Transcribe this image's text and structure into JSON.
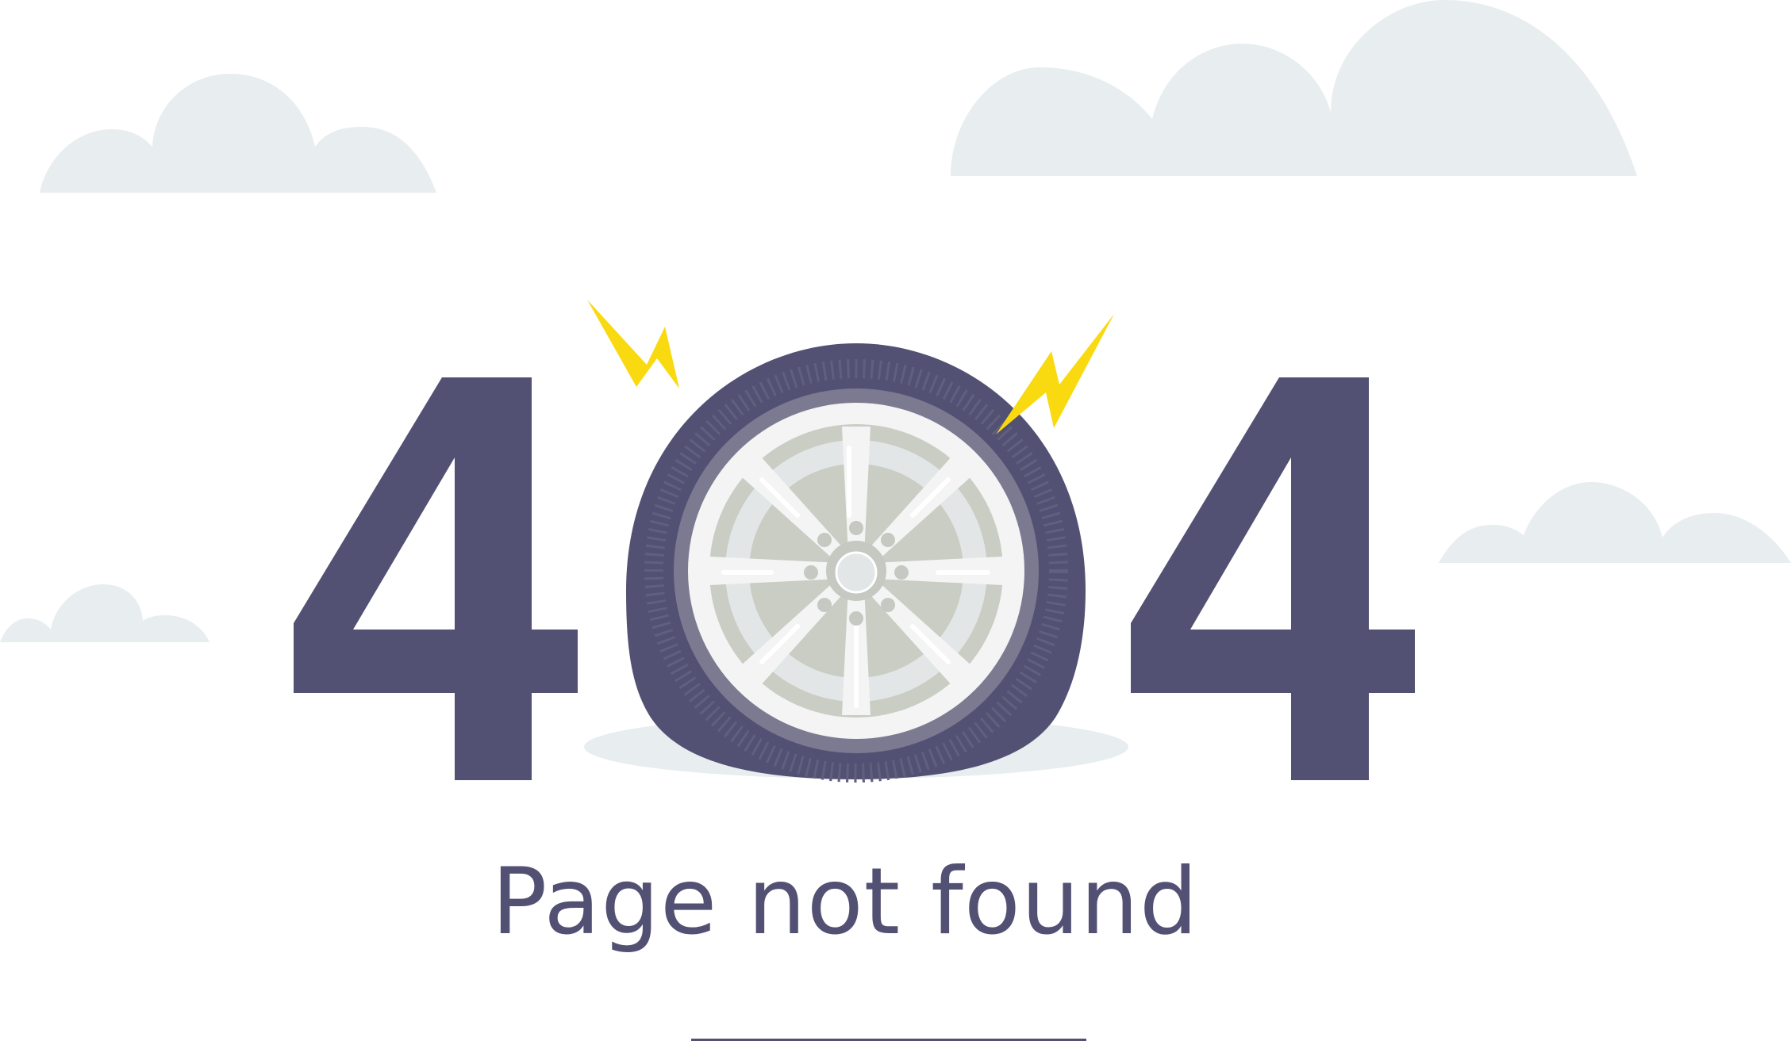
{
  "error": {
    "code_digits": [
      "4",
      "4"
    ],
    "message": "Page not found"
  },
  "colors": {
    "digits": "#535173",
    "text": "#535173",
    "tire": "#535173",
    "tire_inner_ring": "#7b7a91",
    "rim": "#f4f4f4",
    "rim_shadow": "#c9cdc4",
    "rim_inner": "#e2e6e7",
    "bolts": "#c6c8c2",
    "clouds": "#e8edef",
    "ground_shadow": "#e8edef",
    "lightning": "#f9d90f",
    "divider": "#535173"
  },
  "icons": {
    "tire": "flat-tire-icon",
    "spark_left": "lightning-bolt-icon",
    "spark_right": "lightning-bolt-icon"
  }
}
